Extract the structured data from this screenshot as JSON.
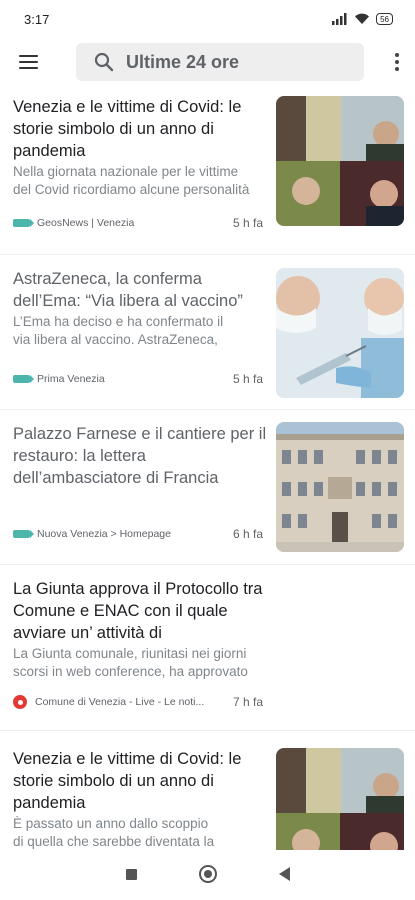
{
  "status_bar": {
    "time": "3:17",
    "battery": "56"
  },
  "app_bar": {
    "search_text": "Ultime 24 ore"
  },
  "articles": [
    {
      "title": "Venezia e le vittime di Covid: le storie simbolo di un anno di pandemia",
      "snippet_lines": [
        "Nella giornata nazionale per le vittime",
        "del Covid ricordiamo alcune personalità"
      ],
      "source": "GeosNews | Venezia",
      "time": "5 h fa",
      "read": false
    },
    {
      "title": "AstraZeneca, la conferma dell’Ema: “Via libera al vaccino”",
      "snippet_lines": [
        "L’Ema ha deciso e ha confermato il",
        "via libera al vaccino. AstraZeneca,"
      ],
      "source": "Prima Venezia",
      "time": "5 h fa",
      "read": true
    },
    {
      "title": "Palazzo Farnese e il cantiere per il restauro: la lettera dell’ambasciatore di Francia",
      "snippet_lines": [],
      "source": "Nuova Venezia > Homepage",
      "time": "6 h fa",
      "read": true
    },
    {
      "title": "La Giunta approva il Protocollo tra Comune e ENAC con il quale avviare un’ attività di",
      "snippet_lines": [
        "La Giunta comunale, riunitasi nei giorni",
        "scorsi in web conference, ha approvato"
      ],
      "source": "Comune di Venezia - Live - Le noti...",
      "time": "7 h fa",
      "read": false
    },
    {
      "title": "Venezia e le vittime di Covid: le storie simbolo di un anno di pandemia",
      "snippet_lines": [
        "È passato un anno dallo scoppio",
        "di quella che sarebbe diventata la"
      ],
      "source": "",
      "time": "",
      "read": false
    }
  ]
}
